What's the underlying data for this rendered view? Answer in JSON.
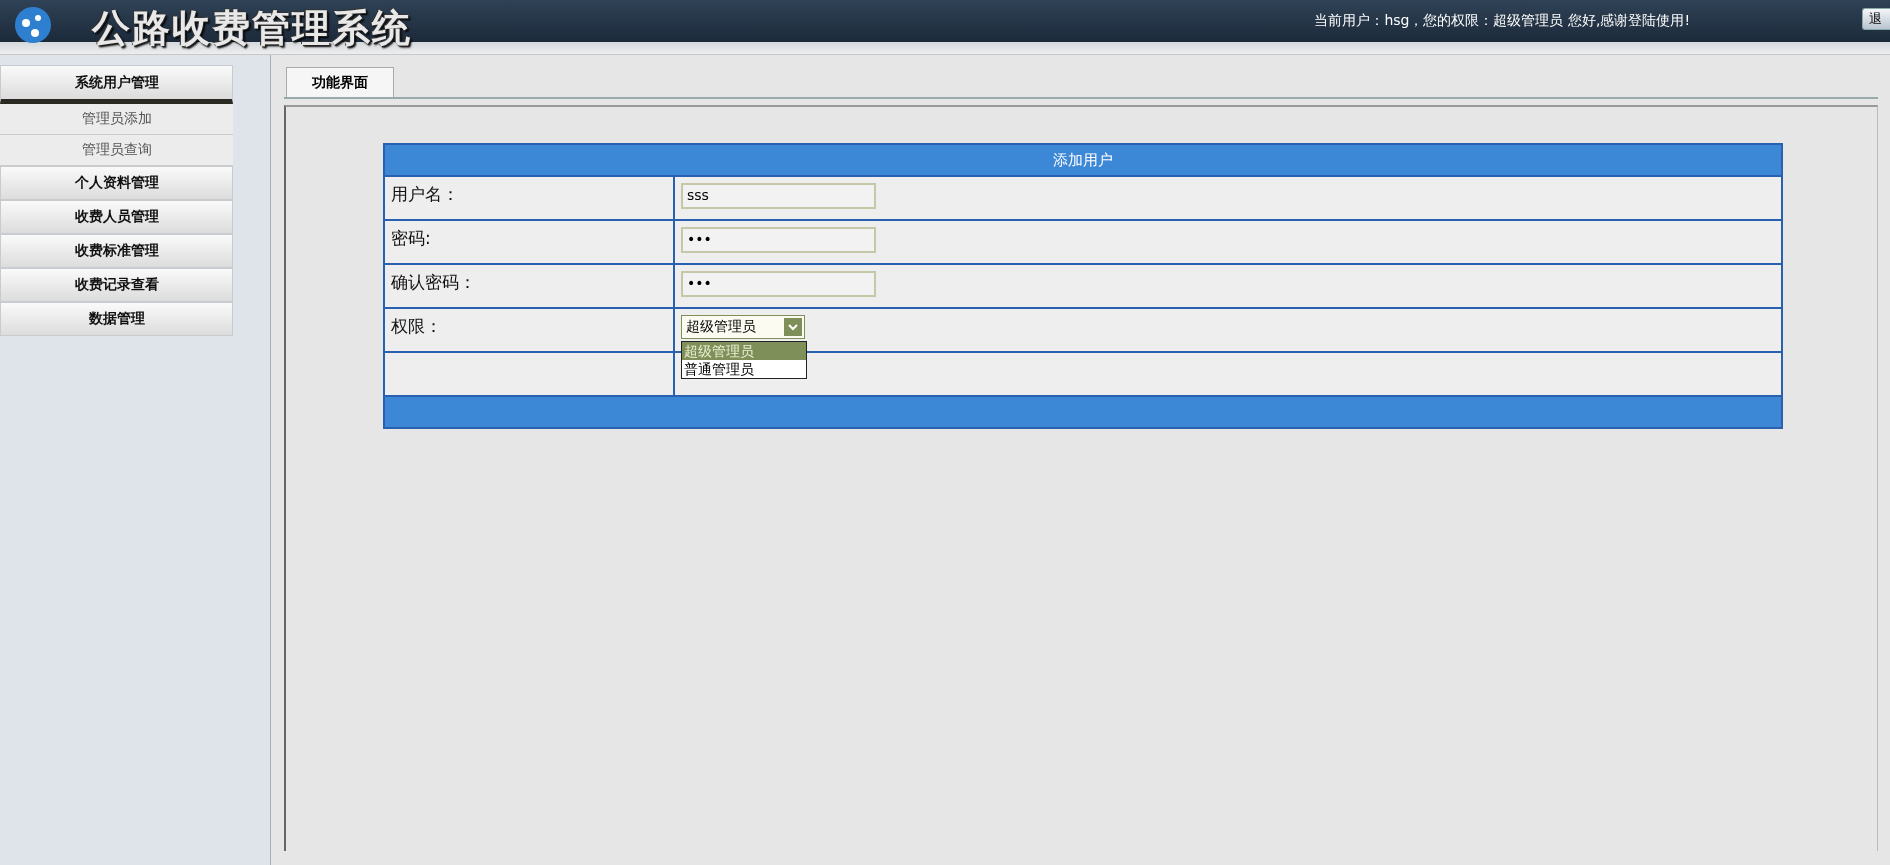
{
  "header": {
    "title": "公路收费管理系统",
    "user_info": "当前用户：hsg，您的权限：超级管理员 您好,感谢登陆使用!",
    "logout_button": "退"
  },
  "sidebar": {
    "groups": [
      {
        "label": "系统用户管理",
        "expanded": true,
        "children": [
          {
            "label": "管理员添加"
          },
          {
            "label": "管理员查询"
          }
        ]
      },
      {
        "label": "个人资料管理",
        "expanded": false
      },
      {
        "label": "收费人员管理",
        "expanded": false
      },
      {
        "label": "收费标准管理",
        "expanded": false
      },
      {
        "label": "收费记录查看",
        "expanded": false
      },
      {
        "label": "数据管理",
        "expanded": false
      }
    ]
  },
  "tabs": [
    {
      "label": "功能界面",
      "selected": true
    }
  ],
  "form": {
    "title": "添加用户",
    "fields": [
      {
        "kind": "text",
        "label": "用户名：",
        "value": "sss"
      },
      {
        "kind": "password",
        "label": "密码:",
        "value": "•••"
      },
      {
        "kind": "password",
        "label": "确认密码：",
        "value": "•••"
      },
      {
        "kind": "select",
        "label": "权限：",
        "value": "超级管理员",
        "expanded": true,
        "options": [
          {
            "label": "超级管理员",
            "selected": true
          },
          {
            "label": "普通管理员",
            "selected": false
          }
        ]
      },
      {
        "kind": "blank"
      }
    ]
  }
}
